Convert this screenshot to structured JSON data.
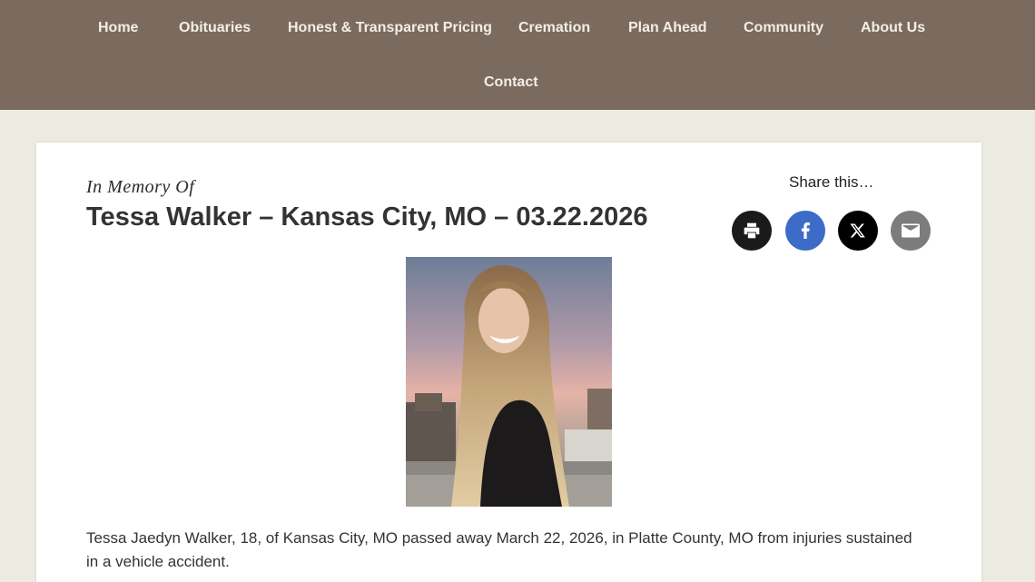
{
  "nav": {
    "items": [
      {
        "label": "Home"
      },
      {
        "label": "Obituaries"
      },
      {
        "label": "Honest & Transparent Pricing"
      },
      {
        "label": "Cremation"
      },
      {
        "label": "Plan Ahead"
      },
      {
        "label": "Community"
      },
      {
        "label": "About Us"
      },
      {
        "label": "Contact"
      }
    ]
  },
  "post": {
    "memory_label": "In Memory Of",
    "title": "Tessa Walker – Kansas City, MO – 03.22.2026",
    "body": "Tessa Jaedyn Walker, 18, of Kansas City, MO passed away March 22, 2026, in Platte County, MO from injuries sustained in a vehicle accident."
  },
  "share": {
    "label": "Share this…",
    "buttons": [
      {
        "icon": "print-icon",
        "color": "#1a1a1a"
      },
      {
        "icon": "facebook-icon",
        "color": "#3d6bc8"
      },
      {
        "icon": "x-icon",
        "color": "#000000"
      },
      {
        "icon": "email-icon",
        "color": "#7c7c7c"
      }
    ]
  },
  "colors": {
    "nav_bg": "#7b6b5e",
    "page_bg": "#ecebe2",
    "nav_text": "#f3eee6"
  }
}
